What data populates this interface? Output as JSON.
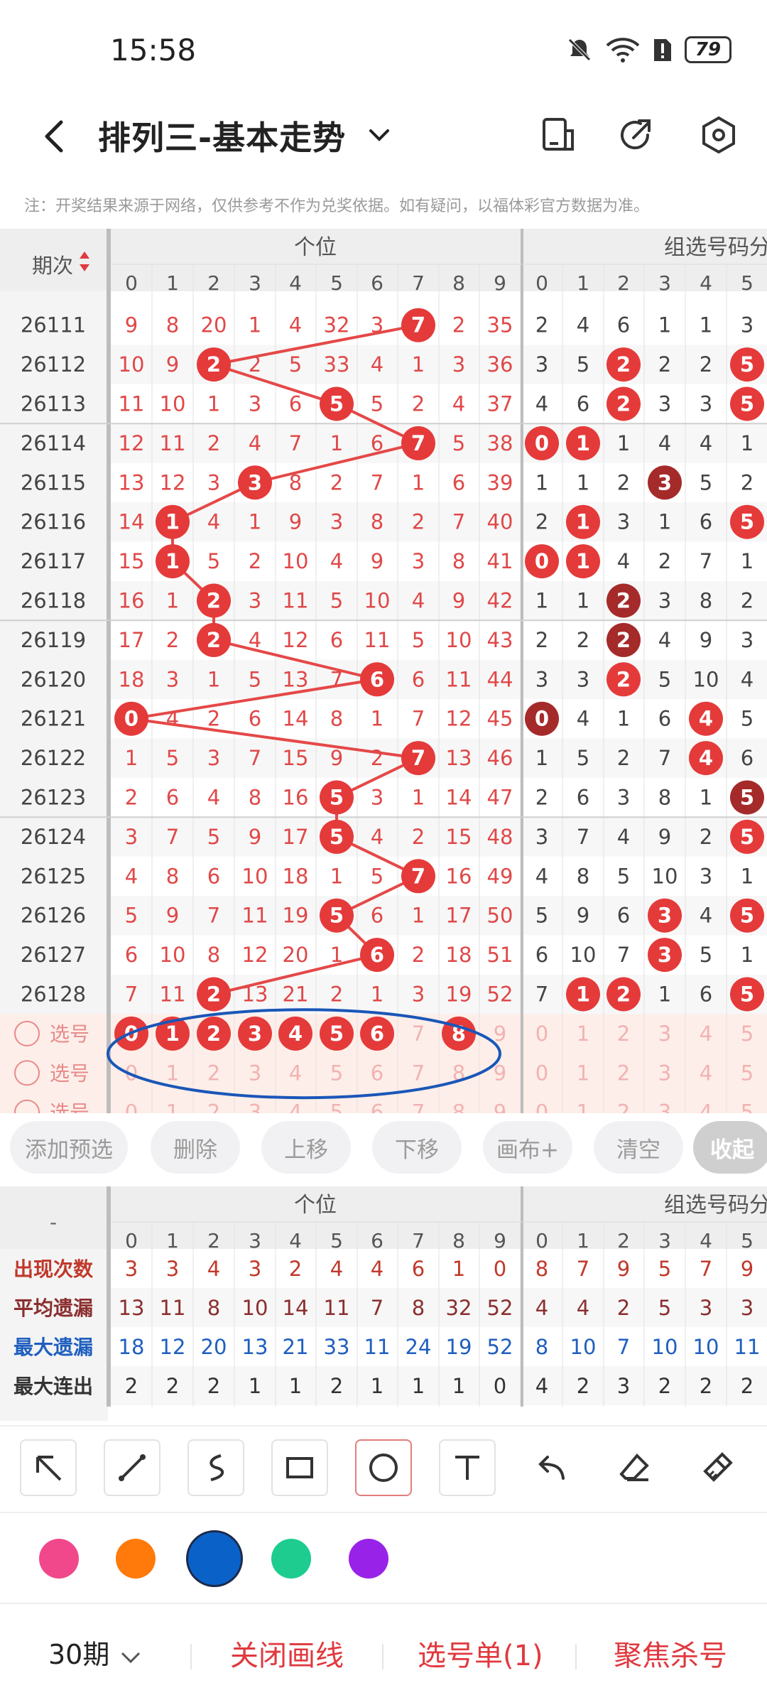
{
  "status_bar": {
    "time": "15:58",
    "battery": "79"
  },
  "header": {
    "title": "排列三-基本走势",
    "icons": [
      "back-icon",
      "chevron-down-icon",
      "phone-icon",
      "share-icon",
      "settings-icon"
    ]
  },
  "notice": "注：开奖结果来源于网络，仅供参考不作为兑奖依据。如有疑问，以福体彩官方数据为准。",
  "trend": {
    "period_header": "期次",
    "section1_title": "个位",
    "section2_title": "组选号码分",
    "digits": [
      "0",
      "1",
      "2",
      "3",
      "4",
      "5",
      "6",
      "7",
      "8",
      "9"
    ],
    "digits2": [
      "0",
      "1",
      "2",
      "3",
      "4",
      "5"
    ],
    "rows": [
      {
        "period": "26111",
        "miss": [
          "9",
          "8",
          "20",
          "1",
          "4",
          "32",
          "3",
          "7",
          "2",
          "35"
        ],
        "hit": 7,
        "g": [
          "2",
          "4",
          "6",
          "1",
          "1",
          "3"
        ],
        "gh": []
      },
      {
        "period": "26112",
        "miss": [
          "10",
          "9",
          "2",
          "2",
          "5",
          "33",
          "4",
          "1",
          "3",
          "36"
        ],
        "hit": 2,
        "g": [
          "3",
          "5",
          "2",
          "2",
          "2",
          "5"
        ],
        "gh": [
          2,
          5
        ]
      },
      {
        "period": "26113",
        "miss": [
          "11",
          "10",
          "1",
          "3",
          "6",
          "5",
          "5",
          "2",
          "4",
          "37"
        ],
        "hit": 5,
        "g": [
          "4",
          "6",
          "2",
          "3",
          "3",
          "5"
        ],
        "gh": [
          2,
          5
        ]
      },
      {
        "period": "26114",
        "miss": [
          "12",
          "11",
          "2",
          "4",
          "7",
          "1",
          "6",
          "7",
          "5",
          "38"
        ],
        "hit": 7,
        "g": [
          "0",
          "1",
          "1",
          "4",
          "4",
          "1"
        ],
        "gh": [
          0,
          1
        ]
      },
      {
        "period": "26115",
        "miss": [
          "13",
          "12",
          "3",
          "3",
          "8",
          "2",
          "7",
          "1",
          "6",
          "39"
        ],
        "hit": 3,
        "g": [
          "1",
          "1",
          "2",
          "3",
          "5",
          "2"
        ],
        "gh": [
          3
        ],
        "gd": [
          3
        ]
      },
      {
        "period": "26116",
        "miss": [
          "14",
          "1",
          "4",
          "1",
          "9",
          "3",
          "8",
          "2",
          "7",
          "40"
        ],
        "hit": 1,
        "g": [
          "2",
          "1",
          "3",
          "1",
          "6",
          "5"
        ],
        "gh": [
          1,
          5
        ]
      },
      {
        "period": "26117",
        "miss": [
          "15",
          "1",
          "5",
          "2",
          "10",
          "4",
          "9",
          "3",
          "8",
          "41"
        ],
        "hit": 1,
        "g": [
          "0",
          "1",
          "4",
          "2",
          "7",
          "1"
        ],
        "gh": [
          0,
          1
        ]
      },
      {
        "period": "26118",
        "miss": [
          "16",
          "1",
          "2",
          "3",
          "11",
          "5",
          "10",
          "4",
          "9",
          "42"
        ],
        "hit": 2,
        "g": [
          "1",
          "1",
          "2",
          "3",
          "8",
          "2"
        ],
        "gh": [
          2
        ],
        "gd": [
          2
        ]
      },
      {
        "period": "26119",
        "miss": [
          "17",
          "2",
          "2",
          "4",
          "12",
          "6",
          "11",
          "5",
          "10",
          "43"
        ],
        "hit": 2,
        "g": [
          "2",
          "2",
          "2",
          "4",
          "9",
          "3"
        ],
        "gh": [
          2
        ],
        "gd": [
          2
        ]
      },
      {
        "period": "26120",
        "miss": [
          "18",
          "3",
          "1",
          "5",
          "13",
          "7",
          "6",
          "6",
          "11",
          "44"
        ],
        "hit": 6,
        "g": [
          "3",
          "3",
          "2",
          "5",
          "10",
          "4"
        ],
        "gh": [
          2
        ]
      },
      {
        "period": "26121",
        "miss": [
          "0",
          "4",
          "2",
          "6",
          "14",
          "8",
          "1",
          "7",
          "12",
          "45"
        ],
        "hit": 0,
        "g": [
          "0",
          "4",
          "1",
          "6",
          "4",
          "5"
        ],
        "gh": [
          0,
          4
        ],
        "gd": [
          0
        ]
      },
      {
        "period": "26122",
        "miss": [
          "1",
          "5",
          "3",
          "7",
          "15",
          "9",
          "2",
          "7",
          "13",
          "46"
        ],
        "hit": 7,
        "g": [
          "1",
          "5",
          "2",
          "7",
          "4",
          "6"
        ],
        "gh": [
          4
        ]
      },
      {
        "period": "26123",
        "miss": [
          "2",
          "6",
          "4",
          "8",
          "16",
          "5",
          "3",
          "1",
          "14",
          "47"
        ],
        "hit": 5,
        "g": [
          "2",
          "6",
          "3",
          "8",
          "1",
          "5"
        ],
        "gh": [
          5
        ],
        "gd": [
          5
        ]
      },
      {
        "period": "26124",
        "miss": [
          "3",
          "7",
          "5",
          "9",
          "17",
          "5",
          "4",
          "2",
          "15",
          "48"
        ],
        "hit": 5,
        "g": [
          "3",
          "7",
          "4",
          "9",
          "2",
          "5"
        ],
        "gh": [
          5
        ]
      },
      {
        "period": "26125",
        "miss": [
          "4",
          "8",
          "6",
          "10",
          "18",
          "1",
          "5",
          "7",
          "16",
          "49"
        ],
        "hit": 7,
        "g": [
          "4",
          "8",
          "5",
          "10",
          "3",
          "1"
        ],
        "gh": []
      },
      {
        "period": "26126",
        "miss": [
          "5",
          "9",
          "7",
          "11",
          "19",
          "5",
          "6",
          "1",
          "17",
          "50"
        ],
        "hit": 5,
        "g": [
          "5",
          "9",
          "6",
          "3",
          "4",
          "5"
        ],
        "gh": [
          3,
          5
        ]
      },
      {
        "period": "26127",
        "miss": [
          "6",
          "10",
          "8",
          "12",
          "20",
          "1",
          "6",
          "2",
          "18",
          "51"
        ],
        "hit": 6,
        "g": [
          "6",
          "10",
          "7",
          "3",
          "5",
          "1"
        ],
        "gh": [
          3
        ]
      },
      {
        "period": "26128",
        "miss": [
          "7",
          "11",
          "2",
          "13",
          "21",
          "2",
          "1",
          "3",
          "19",
          "52"
        ],
        "hit": 2,
        "g": [
          "7",
          "1",
          "2",
          "1",
          "6",
          "5"
        ],
        "gh": [
          1,
          2,
          5
        ]
      }
    ],
    "pick_rows": [
      {
        "label": "选号",
        "selected": [
          0,
          1,
          2,
          3,
          4,
          5,
          6,
          8
        ]
      },
      {
        "label": "选号",
        "selected": []
      },
      {
        "label": "选号",
        "selected": []
      }
    ]
  },
  "actions": [
    "添加预选",
    "删除",
    "上移",
    "下移",
    "画布+",
    "清空",
    "收起"
  ],
  "stats": {
    "corner": "-",
    "section1_title": "个位",
    "section2_title": "组选号码分",
    "rows": [
      {
        "label": "出现次数",
        "values": [
          "3",
          "3",
          "4",
          "3",
          "2",
          "4",
          "4",
          "6",
          "1",
          "0"
        ],
        "g": [
          "8",
          "7",
          "9",
          "5",
          "7",
          "9"
        ],
        "color": "#c0392b"
      },
      {
        "label": "平均遗漏",
        "values": [
          "13",
          "11",
          "8",
          "10",
          "14",
          "11",
          "7",
          "8",
          "32",
          "52"
        ],
        "g": [
          "4",
          "4",
          "2",
          "5",
          "3",
          "3"
        ],
        "color": "#8b2e2e"
      },
      {
        "label": "最大遗漏",
        "values": [
          "18",
          "12",
          "20",
          "13",
          "21",
          "33",
          "11",
          "24",
          "19",
          "52"
        ],
        "g": [
          "8",
          "10",
          "7",
          "10",
          "10",
          "11"
        ],
        "color": "#1f5fbf"
      },
      {
        "label": "最大连出",
        "values": [
          "2",
          "2",
          "2",
          "1",
          "1",
          "2",
          "1",
          "1",
          "1",
          "0"
        ],
        "g": [
          "4",
          "2",
          "3",
          "2",
          "2",
          "2"
        ],
        "color": "#333333"
      }
    ]
  },
  "tools": [
    "arrow-tool-icon",
    "line-tool-icon",
    "curve-tool-icon",
    "rectangle-tool-icon",
    "circle-tool-icon",
    "text-tool-icon",
    "undo-icon",
    "eraser-icon",
    "clear-brush-icon"
  ],
  "palette": [
    "#f0488a",
    "#ff7a0a",
    "#0a62c9",
    "#1dcc8e",
    "#9922e8"
  ],
  "bottom_bar": {
    "period": "30期",
    "close_lines": "关闭画线",
    "pick_list": "选号单(1)",
    "focus_kill": "聚焦杀号"
  },
  "annotation": {
    "shape": "ellipse",
    "color": "#1a56b8"
  }
}
